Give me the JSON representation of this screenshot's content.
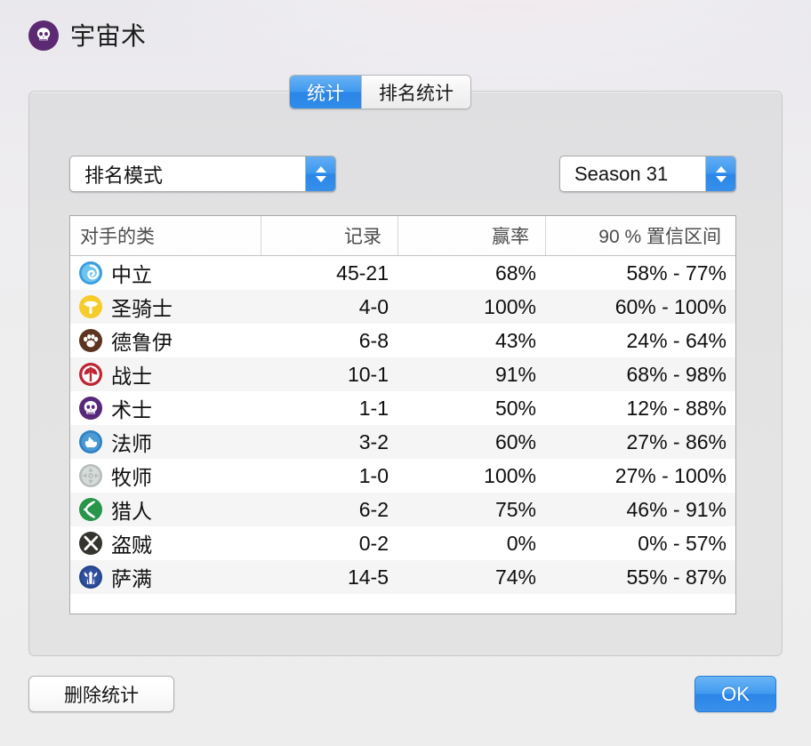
{
  "window": {
    "title": "宇宙术",
    "title_icon": "skull-icon",
    "title_icon_color": "#5b2a72"
  },
  "tabs": [
    {
      "id": "tab-stats",
      "label": "统计",
      "active": true
    },
    {
      "id": "tab-ranked-stats",
      "label": "排名统计",
      "active": false
    }
  ],
  "filters": {
    "mode": {
      "value": "排名模式",
      "icon": "stepper-updown-icon"
    },
    "season": {
      "value": "Season 31",
      "icon": "stepper-updown-icon"
    }
  },
  "table": {
    "columns": [
      "对手的类",
      "记录",
      "赢率",
      "90 % 置信区间"
    ],
    "rows": [
      {
        "icon": "neutral-icon",
        "icon_color": "#3a9de0",
        "class": "中立",
        "record": "45-21",
        "winrate": "68%",
        "ci": "58% -  77%"
      },
      {
        "icon": "paladin-icon",
        "icon_color": "#f5cc2a",
        "class": "圣骑士",
        "record": "4-0",
        "winrate": "100%",
        "ci": "60% - 100%"
      },
      {
        "icon": "druid-icon",
        "icon_color": "#5c3420",
        "class": "德鲁伊",
        "record": "6-8",
        "winrate": "43%",
        "ci": "24% -  64%"
      },
      {
        "icon": "warrior-icon",
        "icon_color": "#bf2433",
        "class": "战士",
        "record": "10-1",
        "winrate": "91%",
        "ci": "68% -  98%"
      },
      {
        "icon": "warlock-icon",
        "icon_color": "#58277a",
        "class": "术士",
        "record": "1-1",
        "winrate": "50%",
        "ci": "12% -  88%"
      },
      {
        "icon": "mage-icon",
        "icon_color": "#2f81c4",
        "class": "法师",
        "record": "3-2",
        "winrate": "60%",
        "ci": "27% -  86%"
      },
      {
        "icon": "priest-icon",
        "icon_color": "#b7bdbb",
        "class": "牧师",
        "record": "1-0",
        "winrate": "100%",
        "ci": "27% - 100%"
      },
      {
        "icon": "hunter-icon",
        "icon_color": "#27954a",
        "class": "猎人",
        "record": "6-2",
        "winrate": "75%",
        "ci": "46% -  91%"
      },
      {
        "icon": "rogue-icon",
        "icon_color": "#35342f",
        "class": "盗贼",
        "record": "0-2",
        "winrate": "0%",
        "ci": "0% -  57%"
      },
      {
        "icon": "shaman-icon",
        "icon_color": "#26458c",
        "class": "萨满",
        "record": "14-5",
        "winrate": "74%",
        "ci": "55% -  87%"
      }
    ]
  },
  "footer": {
    "delete_label": "删除统计",
    "ok_label": "OK"
  },
  "colors": {
    "accent_blue": "#2b86e8",
    "window_bg": "#ededed",
    "panel_bg": "#e3e3e3"
  }
}
